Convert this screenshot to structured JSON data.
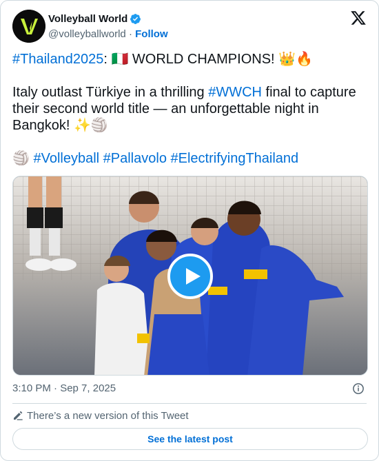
{
  "author": {
    "display_name": "Volleyball World",
    "handle": "@volleyballworld",
    "separator": "·",
    "follow_label": "Follow",
    "verified": true
  },
  "tweet": {
    "line1_tag": "#Thailand2025",
    "line1_rest": ": 🇮🇹 WORLD CHAMPIONS! 👑🔥",
    "p2_a": "Italy outlast Türkiye in a thrilling ",
    "p2_tag": "#WWCH",
    "p2_b": " final to capture their second world title — an unforgettable night in Bangkok! ✨🏐",
    "p3_emoji": "🏐 ",
    "p3_tag1": "#Volleyball",
    "p3_tag2": "#Pallavolo",
    "p3_tag3": "#ElectrifyingThailand"
  },
  "timestamp": "3:10 PM · Sep 7, 2025",
  "notice": "There’s a new version of this Tweet",
  "latest_button": "See the latest post",
  "colors": {
    "link": "#006fd6",
    "play": "#1d9bf0",
    "border": "#cfd9de",
    "muted": "#536471"
  },
  "icons": [
    "verified-badge-icon",
    "x-logo-icon",
    "play-icon",
    "info-icon",
    "pencil-icon"
  ]
}
